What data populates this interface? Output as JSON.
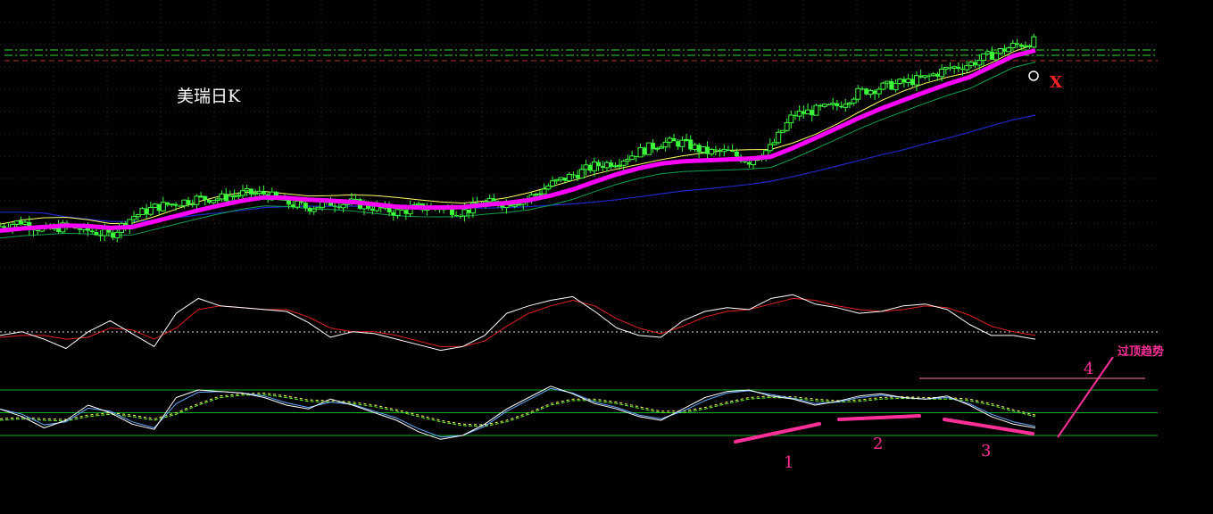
{
  "colors": {
    "background": "#000000",
    "grid": "#2a2a2a",
    "candle": "#3cff3c",
    "ma_magenta": "#ff00ff",
    "ma_yellow": "#ffff66",
    "ma_green": "#0fa050",
    "ma_blue": "#1e28c8",
    "kdj_white": "#ffffff",
    "kdj_red": "#e02020",
    "osc_blue": "#66aaff",
    "osc_green": "#66ff33",
    "annot": "#ff2f9a",
    "x_red": "#ff2020",
    "level_green": "#11aa22",
    "resistance_dash": "#33dd33"
  },
  "labels": {
    "title": "美瑞日K",
    "x_mark": "X",
    "trend_note": "过顶趋势",
    "n1": "1",
    "n2": "2",
    "n3": "3",
    "n4": "4"
  },
  "chart_data": [
    {
      "type": "candlestick",
      "title": "美瑞日K",
      "price": {
        "x": [
          0,
          5,
          10,
          15,
          20,
          25,
          30,
          35,
          40,
          45,
          50,
          55,
          60,
          65,
          70,
          75,
          80,
          85,
          90,
          95,
          100,
          105,
          110,
          115,
          120,
          125,
          130,
          135,
          140,
          145,
          150,
          155,
          160,
          165,
          170,
          175,
          180,
          185,
          190,
          195,
          200,
          205,
          210,
          215,
          220,
          225,
          230,
          235
        ],
        "y": [
          49,
          50,
          48,
          49,
          48,
          47,
          51,
          53,
          54,
          55,
          55,
          56,
          56,
          54,
          53,
          54,
          54,
          53,
          52,
          53,
          53,
          52,
          54,
          54,
          55,
          58,
          60,
          62,
          63,
          65,
          67,
          67,
          65,
          65,
          63,
          66,
          73,
          74,
          75,
          78,
          79,
          80,
          81,
          83,
          84,
          86,
          88,
          89
        ]
      },
      "ma_series": [
        {
          "color": "magenta",
          "values": [
            48,
            48.5,
            48.8,
            49.1,
            49,
            48.6,
            48.8,
            50,
            51.2,
            52.4,
            53.5,
            54.5,
            55.2,
            55.1,
            54.7,
            54.5,
            54.2,
            53.7,
            53.2,
            53,
            53,
            53.1,
            53.6,
            54,
            54.6,
            55.6,
            56.9,
            58.6,
            60.2,
            61.5,
            62.5,
            63,
            63.2,
            63.4,
            63.6,
            64,
            65.9,
            68,
            70.2,
            72.4,
            74.4,
            76.2,
            78,
            79.7,
            81.2,
            83.5,
            85.8,
            87
          ]
        },
        {
          "color": "blue",
          "values": [
            52,
            52,
            51.8,
            51,
            50.5,
            50,
            50,
            50.2,
            50.8,
            51.4,
            51.9,
            52.4,
            53,
            53.2,
            53.3,
            53.3,
            53.3,
            53.2,
            53,
            52.9,
            52.8,
            52.8,
            52.9,
            53,
            53.2,
            53.5,
            53.8,
            54.2,
            54.7,
            55.3,
            56,
            56.6,
            57,
            57.5,
            58,
            58.7,
            59.7,
            60.8,
            62,
            63.2,
            64.4,
            65.5,
            66.8,
            68,
            69.3,
            70.7,
            72,
            73
          ]
        }
      ],
      "resistance_levels": "dashed green lines near the top",
      "annotation": "X"
    },
    {
      "type": "line",
      "series": [
        {
          "color": "white",
          "values": [
            0.4,
            0.6,
            0.2,
            -0.3,
            0.6,
            1.2,
            0.5,
            -0.2,
            1.6,
            2.4,
            2.0,
            1.9,
            1.8,
            1.7,
            1.1,
            0.3,
            0.6,
            0.5,
            0.2,
            -0.1,
            -0.4,
            -0.2,
            0.4,
            1.6,
            2.0,
            2.3,
            2.5,
            1.7,
            0.8,
            0.4,
            0.3,
            1.2,
            1.7,
            1.9,
            1.8,
            2.4,
            2.6,
            2.1,
            1.9,
            1.6,
            1.7,
            2.0,
            2.1,
            1.8,
            1.0,
            0.4,
            0.4,
            0.2
          ]
        },
        {
          "color": "red",
          "values": [
            0.3,
            0.4,
            0.4,
            0.2,
            0.3,
            0.8,
            0.7,
            0.2,
            0.8,
            1.8,
            2.0,
            1.9,
            1.8,
            1.8,
            1.4,
            0.8,
            0.6,
            0.6,
            0.4,
            0.1,
            -0.2,
            -0.2,
            0.1,
            0.9,
            1.6,
            2.0,
            2.3,
            2.0,
            1.3,
            0.8,
            0.5,
            0.9,
            1.4,
            1.7,
            1.8,
            2.1,
            2.4,
            2.3,
            2.0,
            1.8,
            1.7,
            1.8,
            2.0,
            1.9,
            1.5,
            0.9,
            0.6,
            0.4
          ]
        }
      ],
      "zero_line": "dotted"
    },
    {
      "type": "line",
      "series": [
        {
          "color": "white",
          "values": [
            55,
            45,
            30,
            40,
            60,
            50,
            35,
            28,
            70,
            80,
            78,
            76,
            70,
            60,
            55,
            68,
            60,
            50,
            40,
            25,
            15,
            20,
            35,
            55,
            70,
            85,
            75,
            62,
            55,
            45,
            40,
            55,
            70,
            78,
            80,
            72,
            68,
            60,
            65,
            72,
            75,
            70,
            68,
            72,
            60,
            45,
            35,
            30
          ]
        },
        {
          "color": "blue",
          "values": [
            55,
            48,
            34,
            38,
            56,
            52,
            38,
            30,
            62,
            77,
            78,
            76,
            72,
            63,
            57,
            64,
            61,
            52,
            43,
            29,
            18,
            20,
            32,
            52,
            67,
            82,
            76,
            64,
            57,
            47,
            42,
            52,
            66,
            76,
            79,
            74,
            69,
            62,
            64,
            70,
            73,
            70,
            68,
            70,
            62,
            48,
            38,
            32
          ]
        },
        {
          "color": "green",
          "values": [
            40,
            42,
            40,
            39,
            45,
            48,
            45,
            40,
            48,
            60,
            70,
            73,
            74,
            70,
            65,
            64,
            62,
            58,
            52,
            45,
            38,
            33,
            32,
            38,
            48,
            60,
            66,
            66,
            62,
            56,
            50,
            50,
            55,
            62,
            68,
            70,
            69,
            66,
            64,
            65,
            68,
            69,
            68,
            68,
            66,
            60,
            52,
            45
          ]
        }
      ],
      "levels": [
        80,
        50,
        20
      ],
      "annotations": [
        "1",
        "2",
        "3",
        "4",
        "过顶趋势"
      ]
    }
  ]
}
